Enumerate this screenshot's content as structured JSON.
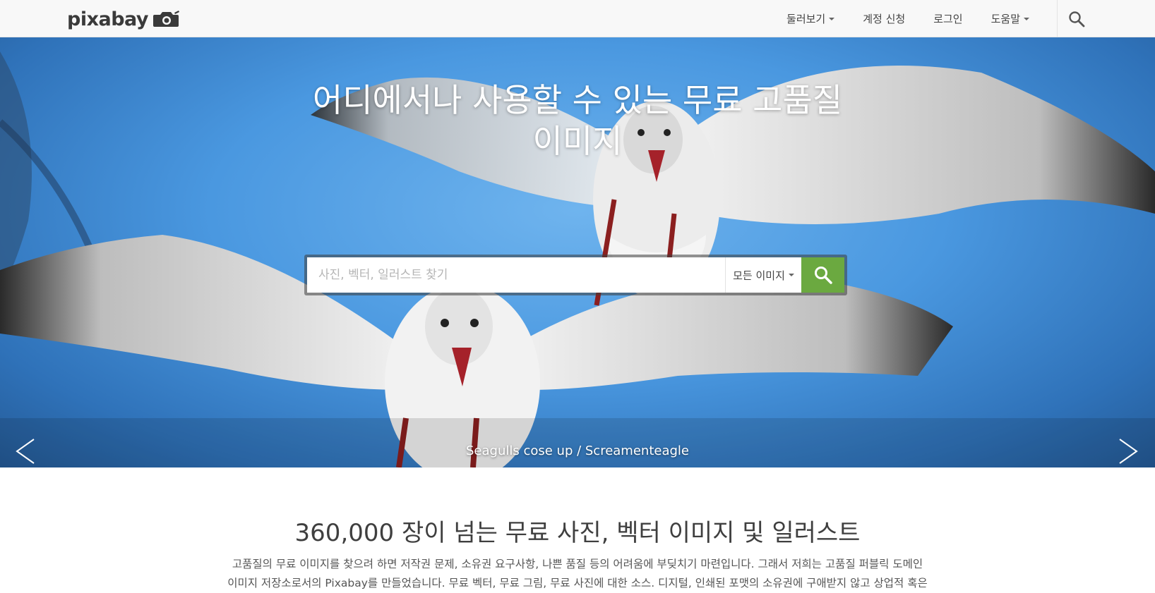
{
  "brand": {
    "logo_text": "pixabay"
  },
  "nav": {
    "explore": "둘러보기",
    "signup": "계정 신청",
    "login": "로그인",
    "help": "도움말"
  },
  "hero": {
    "title_line1": "어디에서나 사용할 수 있는 무료 고품질",
    "title_line2": "이미지",
    "caption": "Seagulls cose up / Screamenteagle"
  },
  "search": {
    "placeholder": "사진, 벡터, 일러스트 찾기",
    "type_selected": "모든 이미지"
  },
  "content": {
    "title": "360,000 장이 넘는 무료 사진, 벡터 이미지 및 일러스트",
    "desc_line1": "고품질의 무료 이미지를 찾으려 하면 저작권 문제, 소유권 요구사항, 나쁜 품질 등의 어려움에 부딪치기 마련입니다. 그래서 저희는 고품질 퍼블릭 도메인",
    "desc_line2": "이미지 저장소로서의 Pixabay를 만들었습니다. 무료 벡터, 무료 그림, 무료 사진에 대한 소스. 디지털, 인쇄된 포맷의 소유권에 구애받지 않고 상업적 혹은"
  },
  "colors": {
    "search_button": "#6ba940",
    "header_bg": "#f8f8f8",
    "sky": "#4a98e0"
  },
  "icons": {
    "search": "search-icon",
    "camera": "camera-icon",
    "prev": "chevron-left-icon",
    "next": "chevron-right-icon"
  }
}
